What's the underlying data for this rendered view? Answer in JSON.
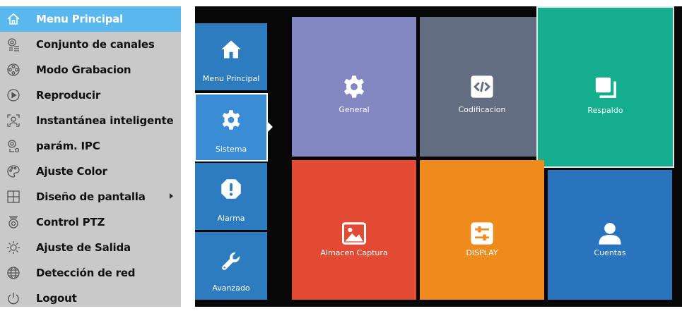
{
  "menu": {
    "items": [
      {
        "label": "Menu Principal",
        "icon": "home-icon"
      },
      {
        "label": "Conjunto de canales",
        "icon": "camera-list-icon"
      },
      {
        "label": "Modo Grabacion",
        "icon": "film-reel-icon"
      },
      {
        "label": "Reproducir",
        "icon": "play-circle-icon"
      },
      {
        "label": "Instantánea inteligente",
        "icon": "face-detect-icon"
      },
      {
        "label": "parám. IPC",
        "icon": "camera-settings-icon"
      },
      {
        "label": "Ajuste Color",
        "icon": "palette-icon"
      },
      {
        "label": "Diseño de pantalla",
        "icon": "grid-layout-icon"
      },
      {
        "label": "Control PTZ",
        "icon": "ptz-camera-icon"
      },
      {
        "label": "Ajuste de Salida",
        "icon": "brightness-icon"
      },
      {
        "label": "Detección de red",
        "icon": "globe-icon"
      },
      {
        "label": "Logout",
        "icon": "power-icon"
      }
    ],
    "active_color": "#5bb8ee",
    "background_color": "#c9c9c9"
  },
  "sidebar": {
    "items": [
      {
        "label": "Menu Principal",
        "icon": "home-icon"
      },
      {
        "label": "Sistema",
        "icon": "gear-icon"
      },
      {
        "label": "Alarma",
        "icon": "alert-icon"
      },
      {
        "label": "Avanzado",
        "icon": "wrench-icon"
      }
    ],
    "selected": "Sistema",
    "color": "#2d7cbf"
  },
  "tiles": [
    {
      "label": "General",
      "icon": "gear-icon",
      "color": "#8488c2"
    },
    {
      "label": "Codificacion",
      "icon": "code-icon",
      "color": "#636d82"
    },
    {
      "label": "Respaldo",
      "icon": "copy-icon",
      "color": "#14ad8d"
    },
    {
      "label": "Almacen Captura",
      "icon": "image-icon",
      "color": "#e34a33"
    },
    {
      "label": "DISPLAY",
      "icon": "sliders-icon",
      "color": "#ef8a1c"
    },
    {
      "label": "Cuentas",
      "icon": "user-icon",
      "color": "#2a74bd"
    }
  ]
}
